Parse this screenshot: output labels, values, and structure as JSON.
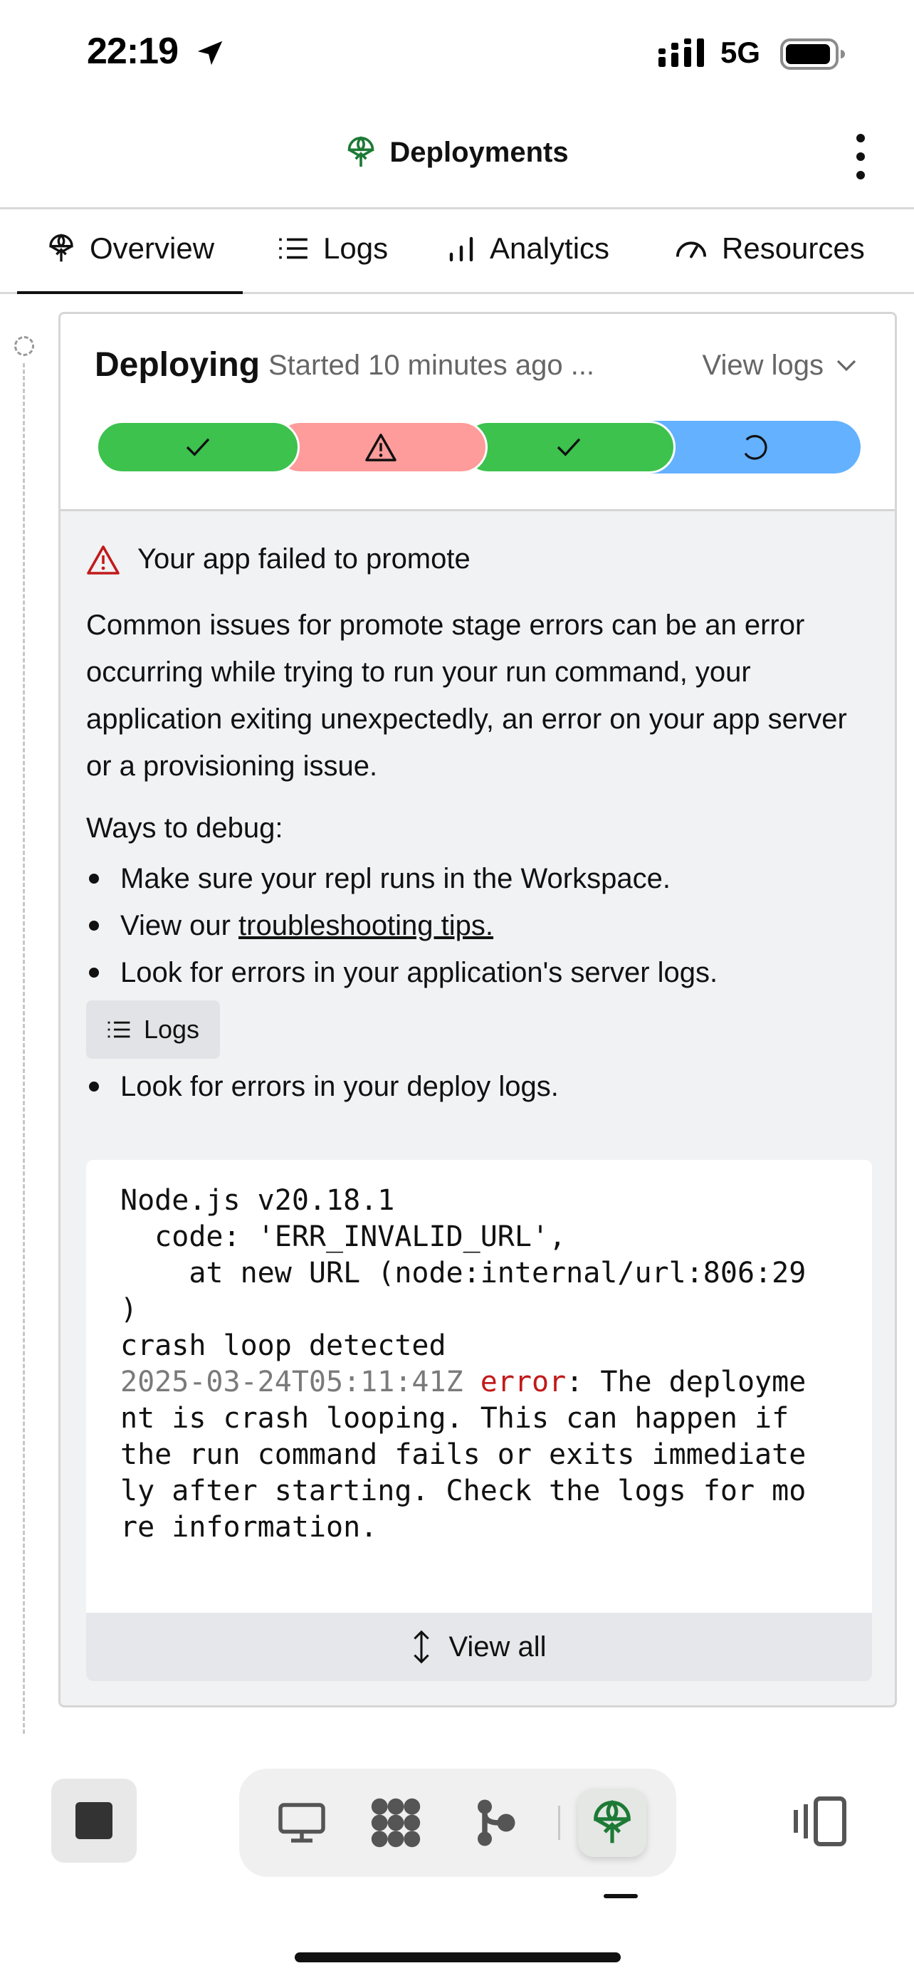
{
  "status_bar": {
    "time": "22:19",
    "network": "5G"
  },
  "header": {
    "title": "Deployments"
  },
  "tabs": [
    {
      "label": "Overview",
      "icon": "deploy-icon",
      "active": true
    },
    {
      "label": "Logs",
      "icon": "list-icon"
    },
    {
      "label": "Analytics",
      "icon": "bar-chart-icon"
    },
    {
      "label": "Resources",
      "icon": "gauge-icon"
    }
  ],
  "deployment": {
    "status": "Deploying",
    "started": "Started 10 minutes ago ...",
    "view_logs": "View logs",
    "stages": [
      {
        "state": "success",
        "icon": "check-icon"
      },
      {
        "state": "warning",
        "icon": "warning-icon"
      },
      {
        "state": "success",
        "icon": "check-icon"
      },
      {
        "state": "in-progress",
        "icon": "spinner-icon"
      }
    ],
    "colors": {
      "success": "#3cc24d",
      "warning": "#fe9b9b",
      "progress": "#64b1ff"
    }
  },
  "error": {
    "title": "Your app failed to promote",
    "body": "Common issues for promote stage errors can be an error occurring while trying to run your run command, your application exiting unexpectedly, an error on your app server or a provisioning issue.",
    "ways_title": "Ways to debug:",
    "bullets": {
      "b1": "Make sure your repl runs in the Workspace.",
      "b2_prefix": "View our ",
      "b2_link": "troubleshooting tips.",
      "b3": "Look for errors in your application's server logs.",
      "logs_button": "Logs",
      "b4": "Look for errors in your deploy logs."
    }
  },
  "log": {
    "line1": "Node.js v20.18.1",
    "line2": "  code: 'ERR_INVALID_URL',",
    "line3": "    at new URL (node:internal/url:806:29",
    "line4": ")",
    "line5": "crash loop detected",
    "line6_ts": "2025-03-24T05:11:41Z",
    "line6_level": "error",
    "line6_rest": ": The deployme",
    "line7": "nt is crash looping. This can happen if",
    "line8": "the run command fails or exits immediate",
    "line9": "ly after starting. Check the logs for mo",
    "line10": "re information."
  },
  "view_all": "View all",
  "toolbar": {
    "items": [
      "stop-icon",
      "desktop-icon",
      "apps-grid-icon",
      "git-icon",
      "deploy-icon",
      "panes-icon"
    ]
  }
}
